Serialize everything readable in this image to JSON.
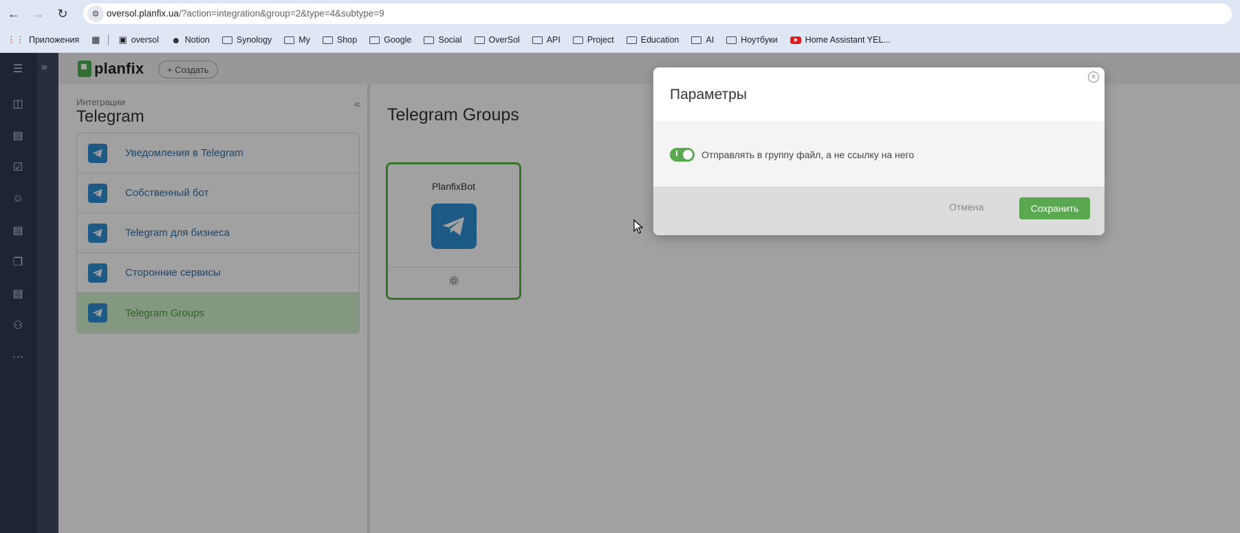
{
  "browser": {
    "url_host": "oversol.planfix.ua",
    "url_path": "/?action=integration&group=2&type=4&subtype=9",
    "bookmarks": [
      {
        "label": "Приложения",
        "icon": "apps-grid-icon"
      },
      {
        "label": "oversol",
        "icon": "planfix-icon"
      },
      {
        "label": "Notion",
        "icon": "avatar-icon"
      },
      {
        "label": "Synology",
        "icon": "folder-icon"
      },
      {
        "label": "My",
        "icon": "folder-icon"
      },
      {
        "label": "Shop",
        "icon": "folder-icon"
      },
      {
        "label": "Google",
        "icon": "folder-icon"
      },
      {
        "label": "Social",
        "icon": "folder-icon"
      },
      {
        "label": "OverSol",
        "icon": "folder-icon"
      },
      {
        "label": "API",
        "icon": "folder-icon"
      },
      {
        "label": "Project",
        "icon": "folder-icon"
      },
      {
        "label": "Education",
        "icon": "folder-icon"
      },
      {
        "label": "AI",
        "icon": "folder-icon"
      },
      {
        "label": "Ноутбуки",
        "icon": "folder-icon"
      },
      {
        "label": "Home Assistant YEL...",
        "icon": "youtube-icon"
      }
    ]
  },
  "header": {
    "logo": "planfix",
    "create_label": "+ Создать"
  },
  "sidepanel": {
    "subtitle": "Интеграции",
    "title": "Telegram",
    "items": [
      {
        "label": "Уведомления в Telegram",
        "active": false
      },
      {
        "label": "Собственный бот",
        "active": false
      },
      {
        "label": "Telegram для бизнеса",
        "active": false
      },
      {
        "label": "Сторонние сервисы",
        "active": false
      },
      {
        "label": "Telegram Groups",
        "active": true
      }
    ]
  },
  "content": {
    "title": "Telegram Groups",
    "bot_name": "PlanfixBot"
  },
  "modal": {
    "title": "Параметры",
    "toggle_label": "Отправлять в группу файл, а не ссылку на него",
    "toggle_on": true,
    "cancel_label": "Отмена",
    "save_label": "Сохранить"
  },
  "colors": {
    "accent_green": "#5aa951",
    "telegram_blue": "#2f8fd4",
    "sidebar_dark": "#2f3c55"
  }
}
